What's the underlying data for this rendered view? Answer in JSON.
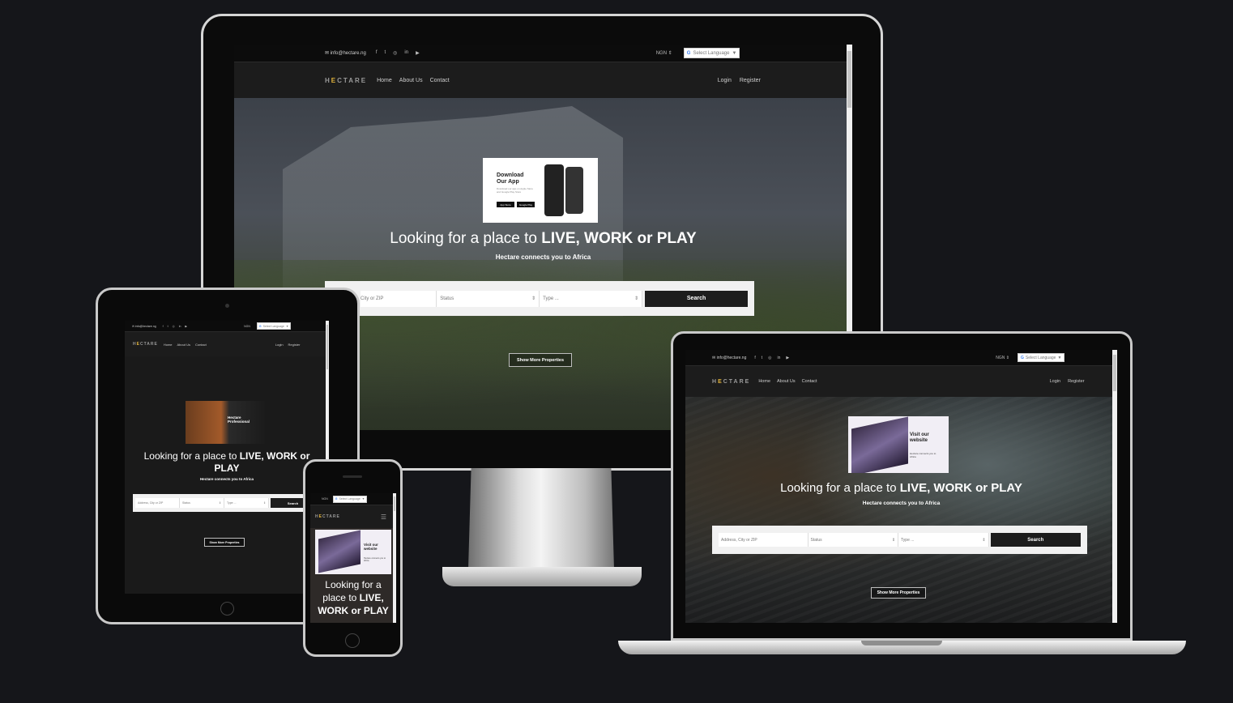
{
  "site": {
    "email": "info@hectare.ng",
    "logo": "HECTARE",
    "currency": "NGN",
    "language_select": "Select Language",
    "nav": [
      "Home",
      "About Us",
      "Contact"
    ],
    "auth": [
      "Login",
      "Register"
    ],
    "hero_title_plain": "Looking for a place to ",
    "hero_title_bold": "LIVE, WORK or PLAY",
    "hero_subtitle": "Hectare connects you to Africa",
    "search": {
      "address_placeholder": "Address, City or ZIP",
      "address_placeholder_desktop": "City or ZIP",
      "status": "Status",
      "type": "Type ...",
      "button": "Search"
    },
    "show_more": "Show More Properties",
    "promo_desktop": {
      "title": "Download Our App",
      "body": "Download our app on Apple Store and Google Play Store",
      "store1": "App Store",
      "store2": "Google Play"
    },
    "promo_tablet": {
      "title": "Hectare Professional"
    },
    "promo_website": {
      "title": "Visit our website",
      "body": "Hectare connects you to Africa"
    }
  },
  "colors": {
    "background": "#15161a",
    "logo_accent": "#e2b43b",
    "button": "#1d1d1d"
  }
}
